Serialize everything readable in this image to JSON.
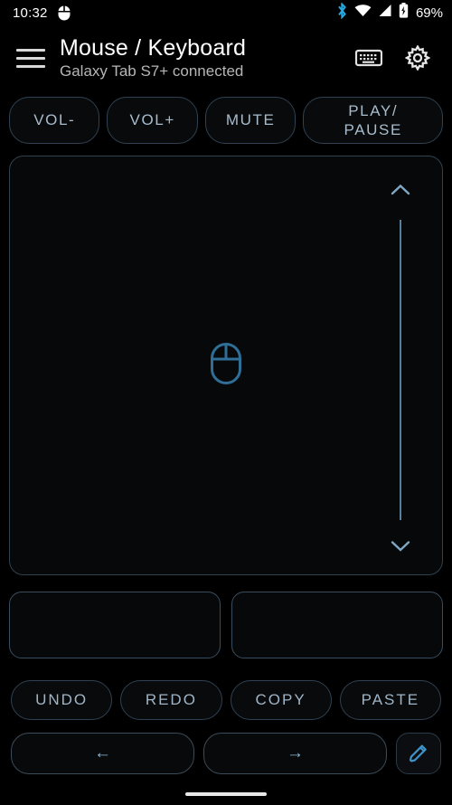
{
  "status_bar": {
    "time": "10:32",
    "mouse_icon": "mouse-icon",
    "bluetooth_icon": "bluetooth-icon",
    "wifi_icon": "wifi-icon",
    "signal_icon": "cellular-signal-icon",
    "battery_icon": "battery-icon",
    "battery_text": "69%",
    "bluetooth_color": "#29a8e0",
    "icon_color": "#ffffff"
  },
  "app_bar": {
    "menu_icon": "hamburger-menu-icon",
    "title": "Mouse / Keyboard",
    "subtitle": "Galaxy Tab S7+ connected",
    "keyboard_icon": "keyboard-icon",
    "settings_icon": "gear-icon"
  },
  "media_buttons": [
    {
      "label": "VOL-",
      "name": "volume-down-button"
    },
    {
      "label": "VOL+",
      "name": "volume-up-button"
    },
    {
      "label": "MUTE",
      "name": "mute-button"
    },
    {
      "label": "PLAY/\nPAUSE",
      "line1": "PLAY/",
      "line2": "PAUSE",
      "name": "play-pause-button"
    }
  ],
  "touchpad": {
    "name": "touchpad-area",
    "center_icon": "mouse-icon",
    "scroll": {
      "up_icon": "chevron-up-icon",
      "down_icon": "chevron-down-icon",
      "track": "scroll-track"
    }
  },
  "click_areas": [
    {
      "name": "left-click-area",
      "label": ""
    },
    {
      "name": "right-click-area",
      "label": ""
    }
  ],
  "edit_buttons": [
    {
      "label": "UNDO",
      "name": "undo-button"
    },
    {
      "label": "REDO",
      "name": "redo-button"
    },
    {
      "label": "COPY",
      "name": "copy-button"
    },
    {
      "label": "PASTE",
      "name": "paste-button"
    }
  ],
  "nav_buttons": {
    "back_label": "←",
    "forward_label": "→",
    "pencil_icon": "pencil-edit-icon"
  },
  "colors": {
    "background": "#000000",
    "accent": "#5a8fb5",
    "button_border": "#2f4152",
    "button_text": "#a8bccd",
    "title_text": "#ffffff",
    "subtitle_text": "#b6b6b6"
  },
  "gesture_bar": "android-gesture-pill"
}
